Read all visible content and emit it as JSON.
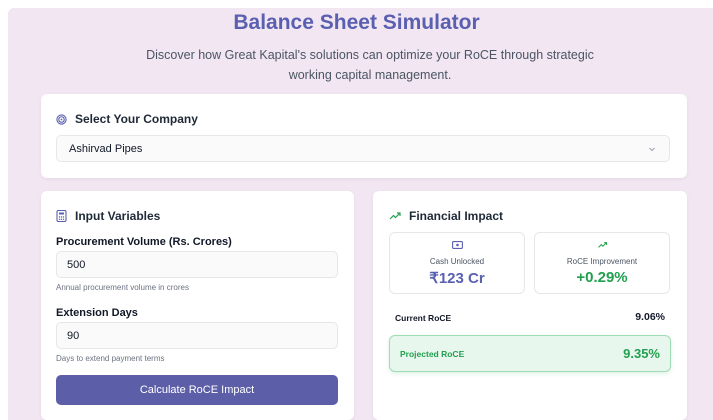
{
  "header": {
    "title": "Balance Sheet Simulator",
    "subtitle": "Discover how Great Kapital's solutions can optimize your RoCE through strategic working capital management."
  },
  "company": {
    "heading": "Select Your Company",
    "icon": "target-icon",
    "selected": "Ashirvad Pipes"
  },
  "inputs": {
    "heading": "Input Variables",
    "icon": "calculator-icon",
    "procurement_label": "Procurement Volume (Rs. Crores)",
    "procurement_value": "500",
    "procurement_hint": "Annual procurement volume in crores",
    "extension_label": "Extension Days",
    "extension_value": "90",
    "extension_hint": "Days to extend payment terms",
    "button_label": "Calculate RoCE Impact"
  },
  "impact": {
    "heading": "Financial Impact",
    "icon": "trending-up-icon",
    "cash_label": "Cash Unlocked",
    "cash_value": "₹123 Cr",
    "roce_label": "RoCE Improvement",
    "roce_value": "+0.29%",
    "current_label": "Current RoCE",
    "current_value": "9.06%",
    "projected_label": "Projected RoCE",
    "projected_value": "9.35%"
  },
  "colors": {
    "accent": "#5a5fb0",
    "button": "#5c5fa8",
    "positive": "#22a04f",
    "background": "#f1e6f1"
  }
}
